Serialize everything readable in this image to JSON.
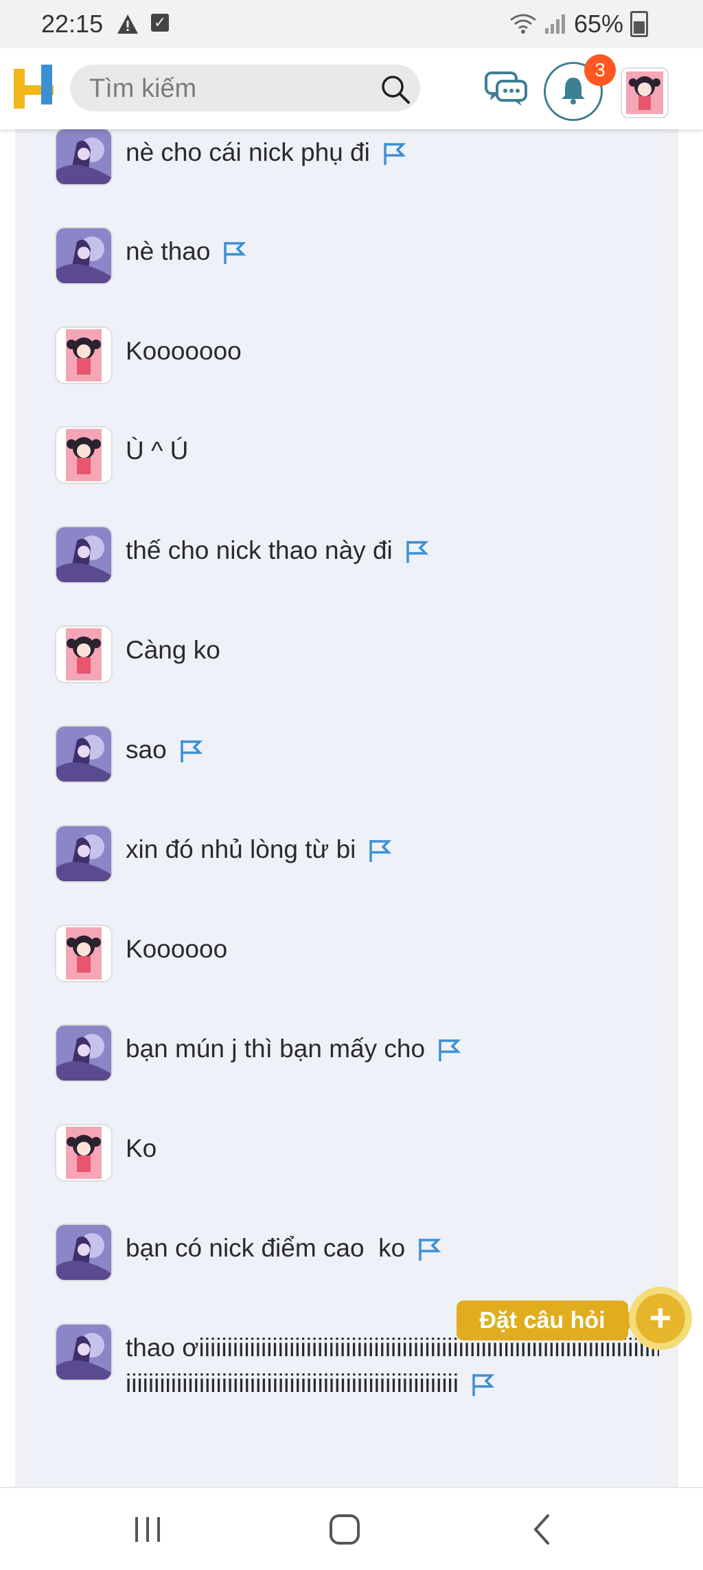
{
  "status_bar": {
    "time": "22:15",
    "battery": "65%"
  },
  "header": {
    "search_placeholder": "Tìm kiếm",
    "notification_count": "3"
  },
  "messages": [
    {
      "sender": "other",
      "text": "nè cho cái nick phụ đi",
      "flag": true
    },
    {
      "sender": "other",
      "text": "nè thao",
      "flag": true
    },
    {
      "sender": "me",
      "text": "Kooooooo",
      "flag": false
    },
    {
      "sender": "me",
      "text": "Ù ^ Ú",
      "flag": false
    },
    {
      "sender": "other",
      "text": "thế cho nick thao này đi",
      "flag": true
    },
    {
      "sender": "me",
      "text": "Càng ko",
      "flag": false
    },
    {
      "sender": "other",
      "text": "sao",
      "flag": true
    },
    {
      "sender": "other",
      "text": "xin đó nhủ lòng từ bi",
      "flag": true
    },
    {
      "sender": "me",
      "text": "Koooooo",
      "flag": false
    },
    {
      "sender": "other",
      "text": "bạn mún j thì bạn mấy cho",
      "flag": true
    },
    {
      "sender": "me",
      "text": "Ko",
      "flag": false
    },
    {
      "sender": "other",
      "text": "bạn có nick điểm cao  ko",
      "flag": true
    },
    {
      "sender": "other",
      "text": "thao ơiiiiiiiiiiiiiiiiiiiiiiiiiiiiiiiiiiiiiiiiiiiiiiiiiiiiiiiiiiiiiiiiiiiiiiiiiiiiiiiiiiiiiiiiiiiiiiiiiiiiiiiiiiiiiiiiiiiiiiiiiiiiiiiiiiiiiiiiiiiiii",
      "flag": true
    }
  ],
  "fab": {
    "label": "Đặt câu hỏi",
    "icon": "plus-icon"
  },
  "colors": {
    "accent_yellow": "#e0ad1f",
    "badge_orange": "#ff5722",
    "flag_blue": "#3b8fd4",
    "bell_teal": "#3d7f93"
  }
}
